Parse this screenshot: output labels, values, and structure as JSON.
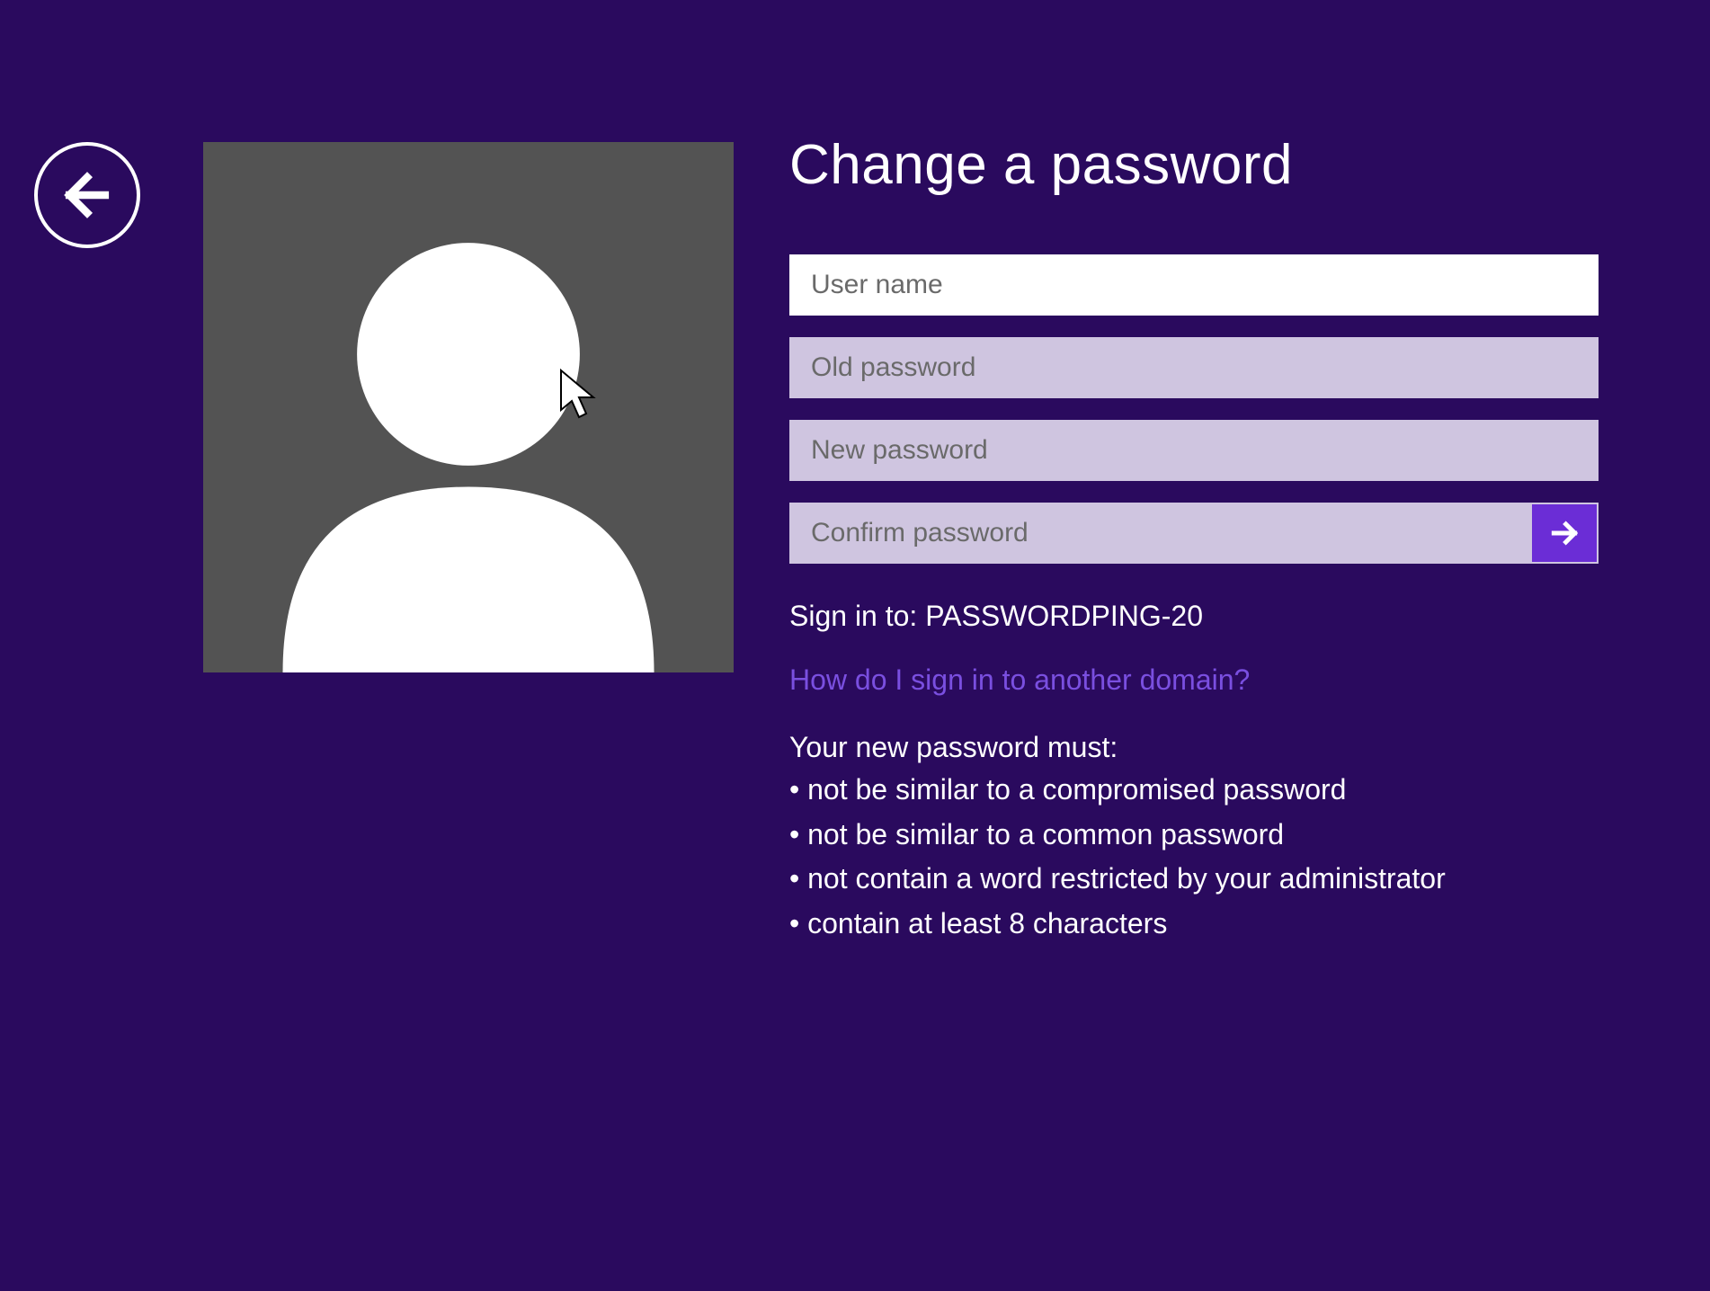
{
  "title": "Change a password",
  "fields": {
    "username": {
      "placeholder": "User name",
      "value": ""
    },
    "oldPassword": {
      "placeholder": "Old password",
      "value": ""
    },
    "newPassword": {
      "placeholder": "New password",
      "value": ""
    },
    "confirmPassword": {
      "placeholder": "Confirm password",
      "value": ""
    }
  },
  "signInTo": "Sign in to: PASSWORDPING-20",
  "helpLink": "How do I sign in to another domain?",
  "rulesIntro": "Your new password must:",
  "rules": [
    "not be similar to a compromised password",
    "not be similar to a common password",
    "not contain a word restricted by your administrator",
    "contain at least 8 characters"
  ],
  "colors": {
    "background": "#2a0a5e",
    "link": "#7a4fe0",
    "submit": "#6b2dd6"
  }
}
